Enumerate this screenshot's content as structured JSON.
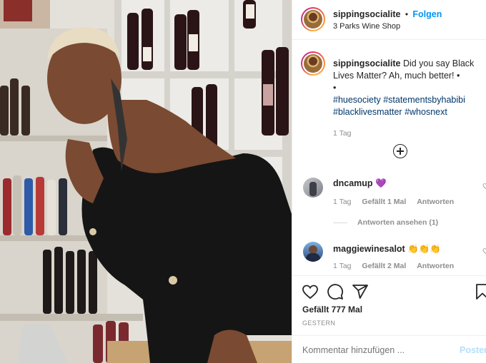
{
  "post": {
    "username": "sippingsocialite",
    "follow_label": "Folgen",
    "separator": "•",
    "location": "3 Parks Wine Shop"
  },
  "caption": {
    "username": "sippingsocialite",
    "text": "Did you say Black Lives Matter? Ah, much better! •",
    "bullet": "•",
    "hashtags": [
      "#huesociety",
      "#statementsbyhabibi",
      "#blacklivesmatter",
      "#whosnext"
    ],
    "time": "1 Tag"
  },
  "comments": [
    {
      "username": "dncamup",
      "text": "💜",
      "time": "1 Tag",
      "likes": "Gefällt 1 Mal",
      "reply": "Antworten",
      "view_replies": "Antworten ansehen (1)"
    },
    {
      "username": "maggiewinesalot",
      "text": "👏👏👏",
      "time": "1 Tag",
      "likes": "Gefällt 2 Mal",
      "reply": "Antworten"
    }
  ],
  "actions": {
    "likes": "Gefällt 777 Mal",
    "date": "GESTERN"
  },
  "add_comment": {
    "placeholder": "Kommentar hinzufügen ...",
    "post_label": "Posten"
  },
  "colors": {
    "link_blue": "#0095f6",
    "hashtag_blue": "#00376b",
    "secondary_text": "#8e8e8e",
    "post_disabled": "#b2dffc"
  },
  "icons": [
    "heart-icon",
    "comment-icon",
    "share-icon",
    "bookmark-icon",
    "add-comments-icon"
  ]
}
